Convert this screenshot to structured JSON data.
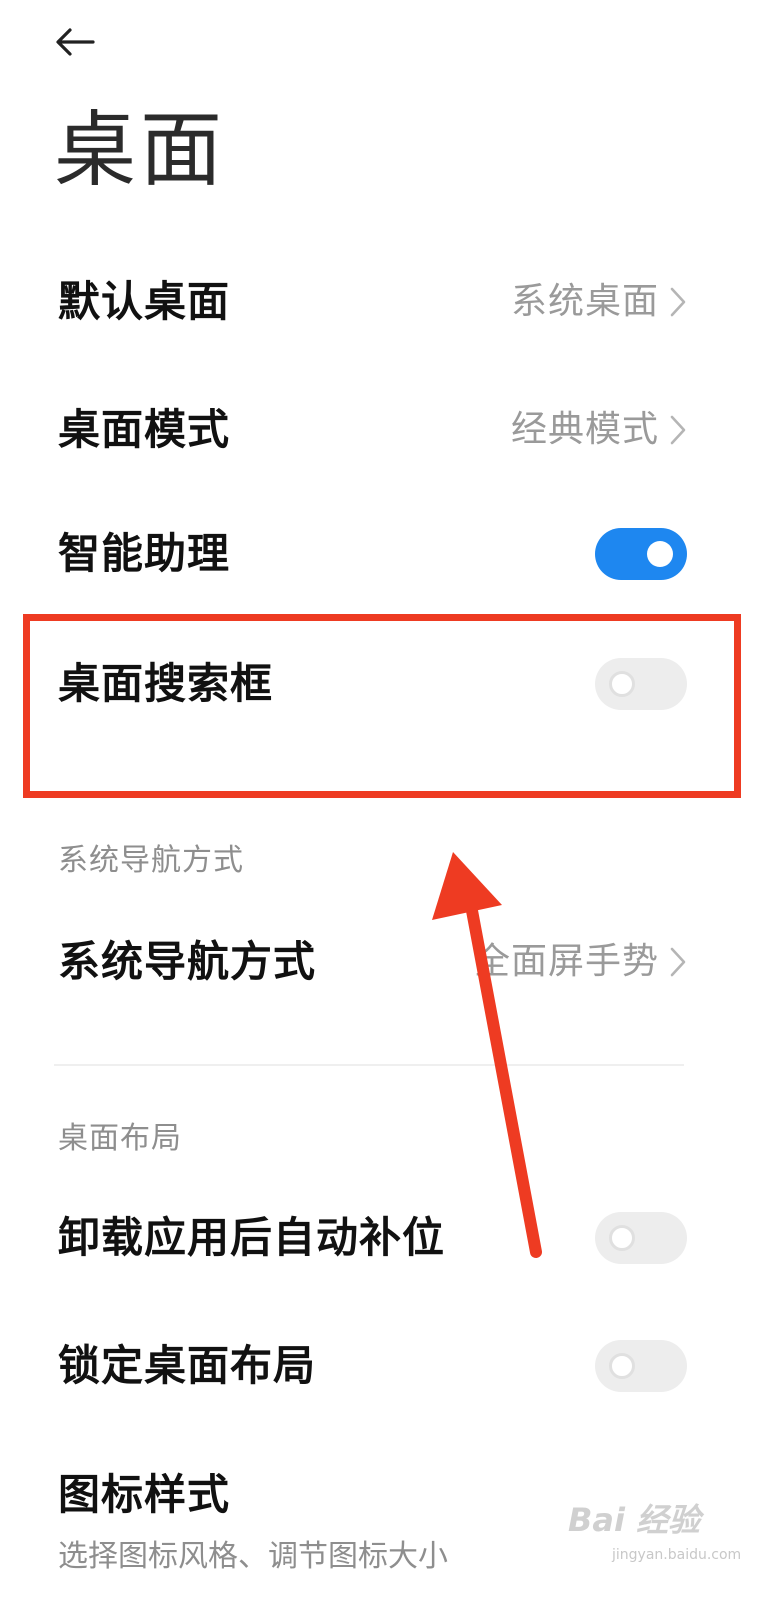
{
  "header": {
    "title": "桌面"
  },
  "rows": {
    "default_launcher": {
      "label": "默认桌面",
      "value": "系统桌面"
    },
    "launcher_mode": {
      "label": "桌面模式",
      "value": "经典模式"
    },
    "smart_assistant": {
      "label": "智能助理",
      "toggle": "on"
    },
    "search_bar": {
      "label": "桌面搜索框",
      "toggle": "off"
    },
    "nav_mode": {
      "label": "系统导航方式",
      "value": "全面屏手势"
    },
    "auto_fill": {
      "label": "卸载应用后自动补位",
      "toggle": "off"
    },
    "lock_layout": {
      "label": "锁定桌面布局",
      "toggle": "off"
    },
    "icon_style": {
      "label": "图标样式",
      "subtext": "选择图标风格、调节图标大小"
    }
  },
  "sections": {
    "navigation": "系统导航方式",
    "layout": "桌面布局"
  },
  "watermark": {
    "brand": "Bai 经验",
    "domain": "jingyan.baidu.com"
  },
  "colors": {
    "accent": "#1e87f0",
    "annotation": "#ee3b22"
  }
}
